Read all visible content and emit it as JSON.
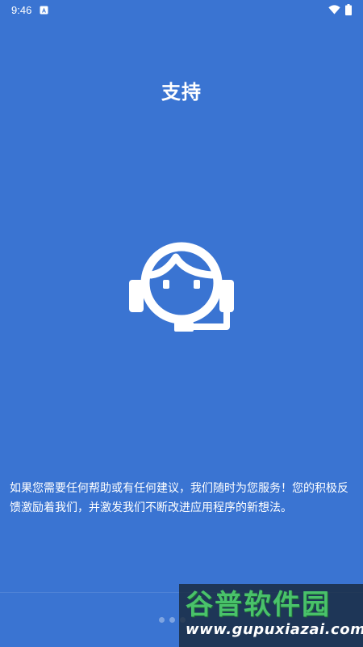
{
  "status_bar": {
    "time": "9:46",
    "notification_icon": "a-notification-icon",
    "wifi_icon": "wifi-icon",
    "battery_icon": "battery-icon"
  },
  "page": {
    "title": "支持",
    "hero_icon": "customer-support-headset-icon",
    "description": "如果您需要任何帮助或有任何建议，我们随时为您服务！您的积极反馈激励着我们，并激发我们不断改进应用程序的新想法。",
    "page_indicator": {
      "count": 3
    }
  },
  "watermark": {
    "cn": "谷普软件园",
    "url": "www.gupuxiazai.com"
  },
  "colors": {
    "background": "#3a74d2",
    "foreground": "#ffffff",
    "watermark_green": "#49c26a"
  }
}
